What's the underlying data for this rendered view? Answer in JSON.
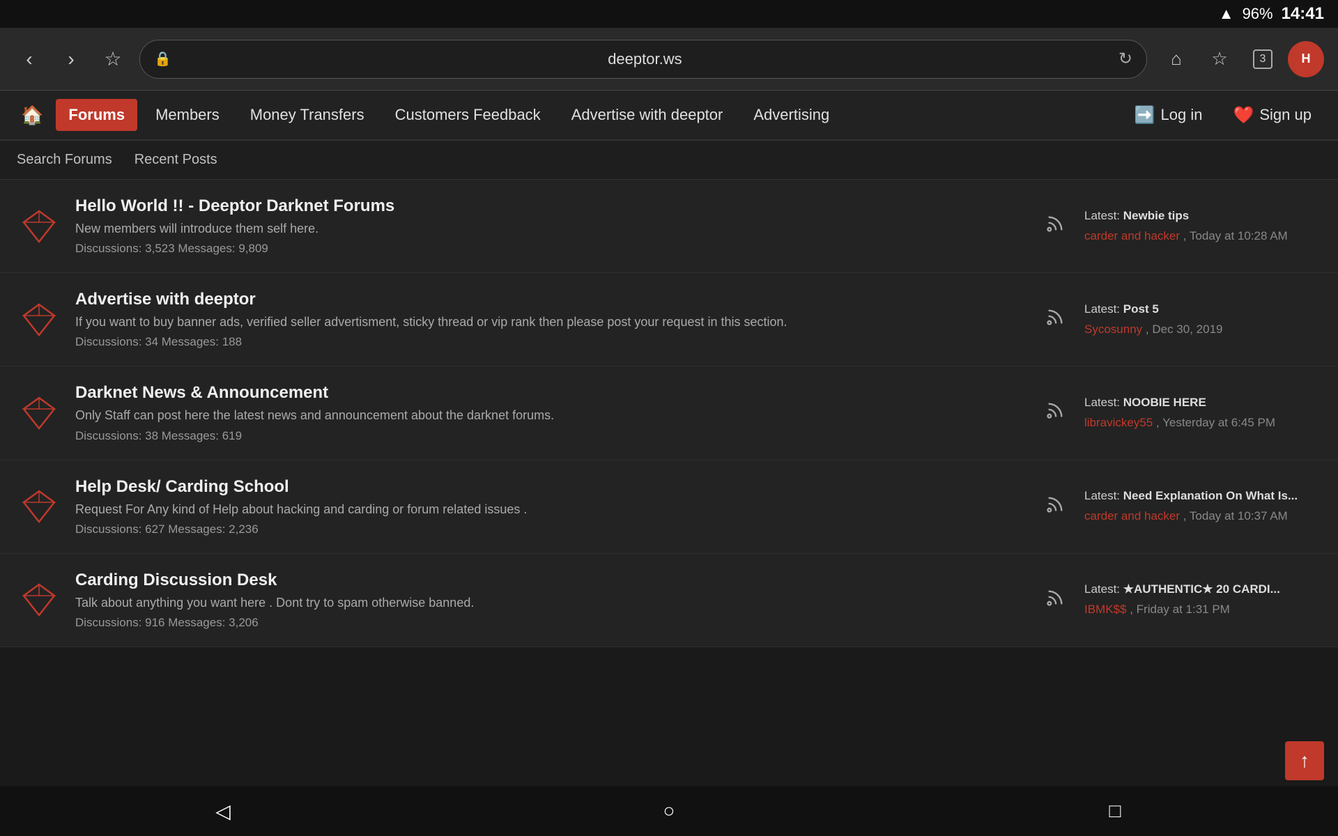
{
  "statusBar": {
    "wifi": "wifi",
    "battery": "96%",
    "time": "14:41"
  },
  "browser": {
    "back": "‹",
    "forward": "›",
    "bookmark": "☆",
    "url": "deeptor.ws",
    "reload": "↻",
    "home": "⌂",
    "favs": "☆",
    "tabs": "3",
    "menu_letter": "H"
  },
  "siteNav": {
    "home": "🏠",
    "items": [
      {
        "id": "forums",
        "label": "Forums",
        "active": true
      },
      {
        "id": "members",
        "label": "Members",
        "active": false
      },
      {
        "id": "money-transfers",
        "label": "Money Transfers",
        "active": false
      },
      {
        "id": "customers-feedback",
        "label": "Customers Feedback",
        "active": false
      },
      {
        "id": "advertise",
        "label": "Advertise with deeptor",
        "active": false
      },
      {
        "id": "advertising",
        "label": "Advertising",
        "active": false
      }
    ],
    "login": "Log in",
    "signup": "Sign up"
  },
  "subNav": {
    "items": [
      {
        "id": "search-forums",
        "label": "Search Forums"
      },
      {
        "id": "recent-posts",
        "label": "Recent Posts"
      }
    ]
  },
  "forums": [
    {
      "id": "hello-world",
      "title": "Hello World !! - Deeptor Darknet Forums",
      "desc": "New members will introduce them self here.",
      "discussions": "3,523",
      "messages": "9,809",
      "latestLabel": "Latest:",
      "latestTitle": "Newbie tips",
      "latestUser": "carder and hacker",
      "latestTime": "Today at 10:28 AM"
    },
    {
      "id": "advertise-with-deeptor",
      "title": "Advertise with deeptor",
      "desc": "If you want to buy banner ads, verified seller advertisment, sticky thread or vip rank then please post your request in this section.",
      "discussions": "34",
      "messages": "188",
      "latestLabel": "Latest:",
      "latestTitle": "Post 5",
      "latestUser": "Sycosunny",
      "latestTime": "Dec 30, 2019"
    },
    {
      "id": "darknet-news",
      "title": "Darknet News & Announcement",
      "desc": "Only Staff can post here the latest news and announcement about the darknet forums.",
      "discussions": "38",
      "messages": "619",
      "latestLabel": "Latest:",
      "latestTitle": "NOOBIE HERE",
      "latestUser": "libravickey55",
      "latestTime": "Yesterday at 6:45 PM"
    },
    {
      "id": "help-desk",
      "title": "Help Desk/ Carding School",
      "desc": "Request For Any kind of Help about hacking and carding or forum related issues .",
      "discussions": "627",
      "messages": "2,236",
      "latestLabel": "Latest:",
      "latestTitle": "Need Explanation On What Is...",
      "latestUser": "carder and hacker",
      "latestTime": "Today at 10:37 AM"
    },
    {
      "id": "carding-discussion",
      "title": "Carding Discussion Desk",
      "desc": "Talk about anything you want here . Dont try to spam otherwise banned.",
      "discussions": "916",
      "messages": "3,206",
      "latestLabel": "Latest:",
      "latestTitle": "★AUTHENTIC★ 20 CARDI...",
      "latestUser": "IBMK$$",
      "latestTime": "Friday at 1:31 PM"
    }
  ],
  "scrollTop": "↑",
  "androidNav": {
    "back": "◁",
    "home": "○",
    "recents": "□"
  }
}
